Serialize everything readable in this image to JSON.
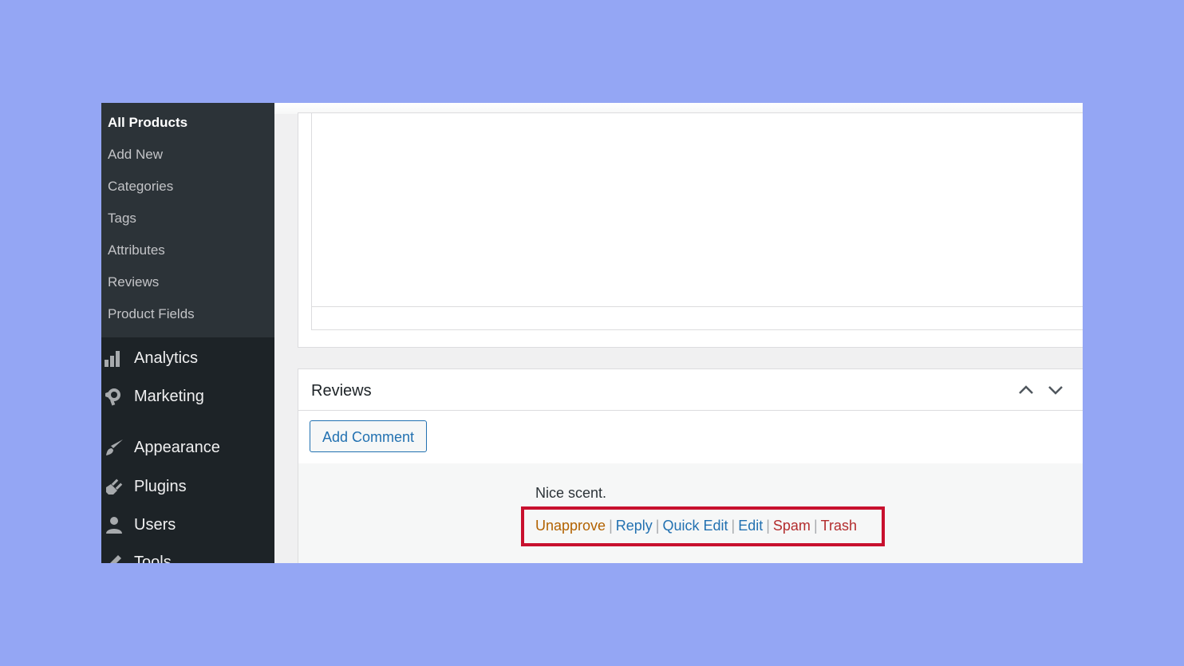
{
  "sidebar": {
    "submenu": [
      {
        "label": "All Products",
        "current": true
      },
      {
        "label": "Add New"
      },
      {
        "label": "Categories"
      },
      {
        "label": "Tags"
      },
      {
        "label": "Attributes"
      },
      {
        "label": "Reviews"
      },
      {
        "label": "Product Fields"
      }
    ],
    "menu": [
      {
        "label": "Analytics",
        "icon": "analytics-icon"
      },
      {
        "label": "Marketing",
        "icon": "megaphone-icon"
      },
      {
        "label": "Appearance",
        "icon": "paintbrush-icon"
      },
      {
        "label": "Plugins",
        "icon": "plugin-icon"
      },
      {
        "label": "Users",
        "icon": "users-icon"
      },
      {
        "label": "Tools",
        "icon": "tools-icon"
      }
    ]
  },
  "reviews": {
    "title": "Reviews",
    "add_comment_label": "Add Comment",
    "comment_text": "Nice scent.",
    "actions": {
      "unapprove": "Unapprove",
      "reply": "Reply",
      "quick_edit": "Quick Edit",
      "edit": "Edit",
      "spam": "Spam",
      "trash": "Trash",
      "separator": "|"
    }
  },
  "colors": {
    "page_background": "#94a6f4",
    "sidebar": "#1d2327",
    "submenu": "#2c3338",
    "link": "#2271b1",
    "unapprove": "#b26200",
    "danger": "#b32d2e",
    "highlight": "#c8102e"
  }
}
